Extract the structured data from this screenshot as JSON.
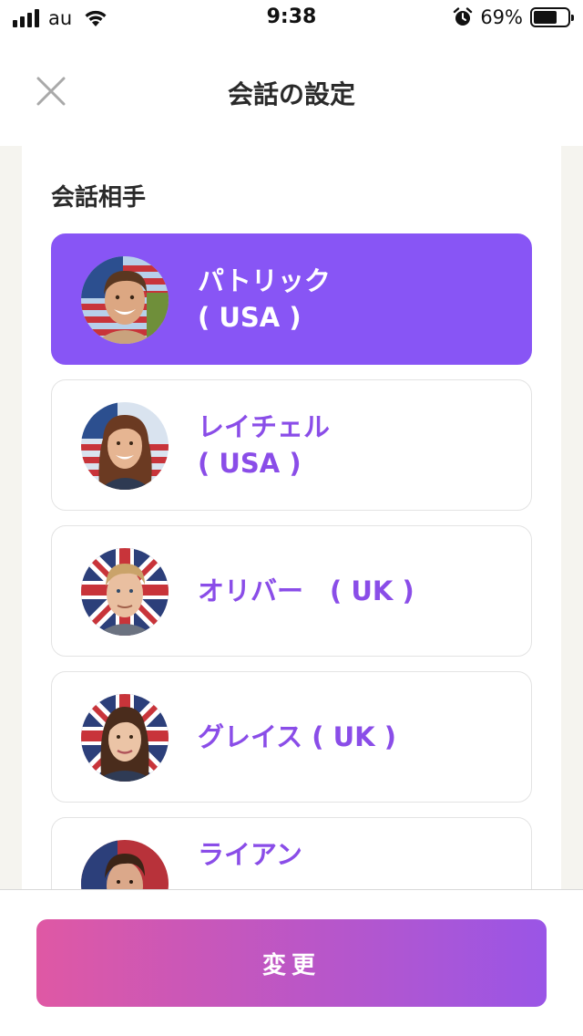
{
  "status_bar": {
    "carrier": "au",
    "time": "9:38",
    "battery_percent": "69%",
    "battery_level": 0.69,
    "icons": [
      "signal-icon",
      "wifi-icon",
      "alarm-icon",
      "battery-icon"
    ]
  },
  "header": {
    "title": "会話の設定",
    "close_icon": "close-icon"
  },
  "section": {
    "title": "会話相手"
  },
  "partners": [
    {
      "line1": "パトリック",
      "line2": "( USA )",
      "selected": true
    },
    {
      "line1": "レイチェル",
      "line2": "( USA )",
      "selected": false
    },
    {
      "line1": "オリバー　( UK )",
      "line2": "",
      "selected": false
    },
    {
      "line1": "グレイス ( UK )",
      "line2": "",
      "selected": false
    },
    {
      "line1": "ライアン",
      "line2": "",
      "selected": false
    }
  ],
  "footer": {
    "change_label": "変更"
  },
  "colors": {
    "accent": "#8855f5",
    "accent_text": "#8a4de8",
    "button_gradient_start": "#df58a4",
    "button_gradient_end": "#9a55e6",
    "content_background": "#f5f4ef"
  }
}
